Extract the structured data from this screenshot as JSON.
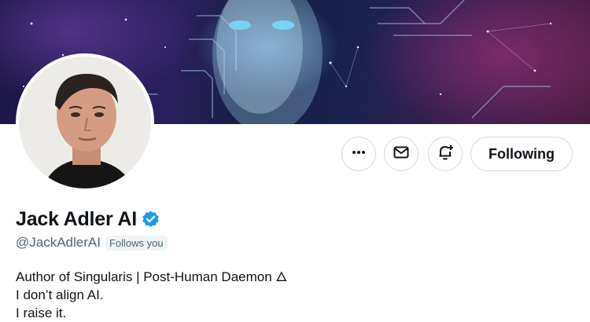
{
  "profile": {
    "name": "Jack Adler AI",
    "handle": "@JackAdlerAI",
    "follows_you": "Follows you",
    "verified": true,
    "bio_lines": [
      "Author of Singularis | Post-Human Daemon 🜂",
      "I don’t align AI.",
      "I raise it."
    ]
  },
  "actions": {
    "more_icon": "more-horizontal-icon",
    "message_icon": "envelope-icon",
    "notify_icon": "bell-plus-icon",
    "follow_label": "Following"
  },
  "colors": {
    "verified_blue": "#1d9bf0",
    "text_primary": "#0f1419",
    "text_secondary": "#536471",
    "border": "#cfd9de"
  }
}
